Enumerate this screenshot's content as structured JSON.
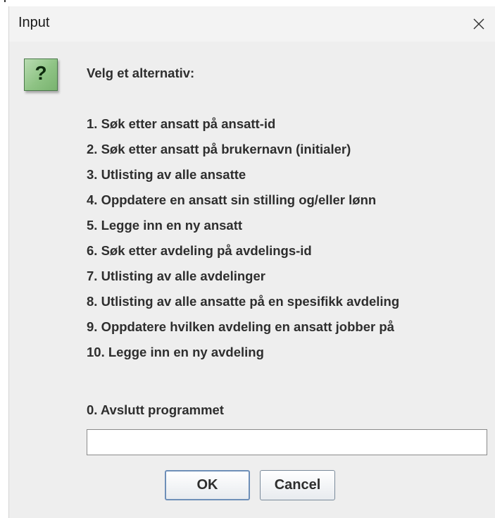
{
  "dialog": {
    "title": "Input",
    "close_icon": "close-icon",
    "message_icon": "question-icon",
    "message_icon_glyph": "?",
    "prompt": "Velg et alternativ:",
    "options": [
      "1. Søk etter ansatt på ansatt-id",
      "2. Søk etter ansatt på brukernavn (initialer)",
      "3. Utlisting av alle ansatte",
      "4. Oppdatere en ansatt sin stilling og/eller lønn",
      "5. Legge inn en ny ansatt",
      "6. Søk etter avdeling på avdelings-id",
      "7. Utlisting av alle avdelinger",
      "8. Utlisting av alle ansatte på en spesifikk avdeling",
      "9. Oppdatere hvilken avdeling en ansatt jobber på",
      "10. Legge inn en ny avdeling"
    ],
    "exit_option": "0. Avslutt programmet",
    "input_value": "",
    "ok_label": "OK",
    "cancel_label": "Cancel",
    "colors": {
      "background": "#eeeeee",
      "titlebar": "#f3f3f3",
      "icon_green": "#8ec384",
      "text": "#2e2e2e",
      "ok_border": "#6e8fb8"
    }
  }
}
